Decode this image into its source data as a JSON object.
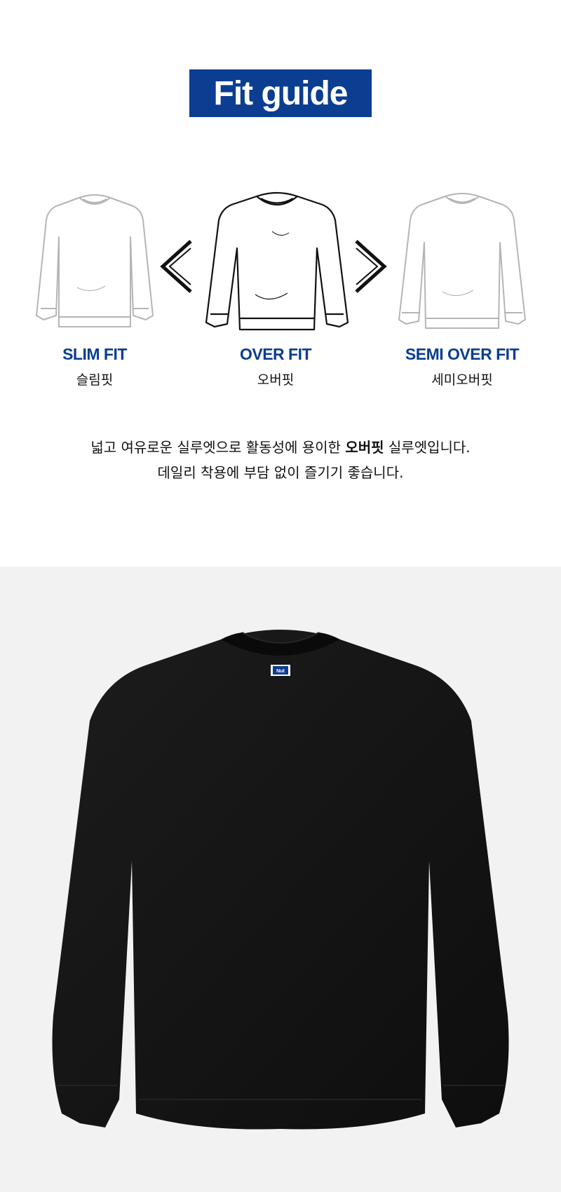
{
  "header": {
    "title": "Fit guide"
  },
  "fits": [
    {
      "name": "SLIM FIT",
      "korean": "슬림핏",
      "state": "inactive"
    },
    {
      "name": "OVER FIT",
      "korean": "오버핏",
      "state": "active"
    },
    {
      "name": "SEMI OVER FIT",
      "korean": "세미오버핏",
      "state": "inactive"
    }
  ],
  "description": {
    "line1_before": "넓고 여유로운 실루엣으로 활동성에 용이한 ",
    "line1_bold": "오버핏",
    "line1_after": " 실루엣입니다.",
    "line2": "데일리 착용에 부담 없이 즐기기 좋습니다."
  },
  "product": {
    "label_text": "Nut"
  },
  "colors": {
    "brand_blue": "#0b3d91",
    "product_bg": "#f2f2f2",
    "garment": "#141414"
  }
}
